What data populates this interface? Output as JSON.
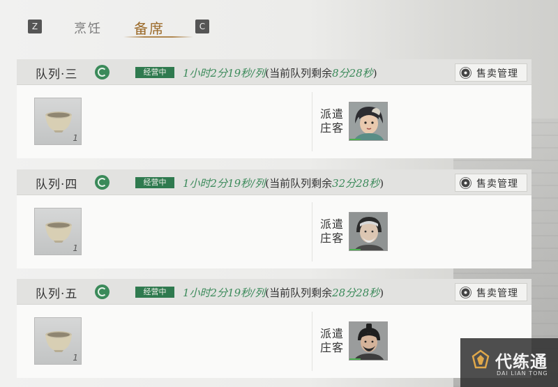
{
  "tabs": {
    "key_left": "Z",
    "key_right": "C",
    "cook": "烹饪",
    "prepare": "备席",
    "active": "prepare"
  },
  "queues": [
    {
      "name": "队列·三",
      "status": "经营中",
      "rate": "1小时2分19秒/列",
      "remain_prefix": "(当前队列剩余",
      "remain_time": "8分28秒",
      "remain_suffix": ")",
      "sell_label": "售卖管理",
      "item_count": "1",
      "item_icon": "ceramic-bowl",
      "dispatch_label": "派遣庄客",
      "portrait": "female-villager"
    },
    {
      "name": "队列·四",
      "status": "经营中",
      "rate": "1小时2分19秒/列",
      "remain_prefix": "(当前队列剩余",
      "remain_time": "32分28秒",
      "remain_suffix": ")",
      "sell_label": "售卖管理",
      "item_count": "1",
      "item_icon": "ceramic-bowl",
      "dispatch_label": "派遣庄客",
      "portrait": "old-man-villager"
    },
    {
      "name": "队列·五",
      "status": "经营中",
      "rate": "1小时2分19秒/列",
      "remain_prefix": "(当前队列剩余",
      "remain_time": "28分28秒",
      "remain_suffix": ")",
      "sell_label": "售卖管理",
      "item_count": "1",
      "item_icon": "ceramic-bowl",
      "dispatch_label": "派遣庄客",
      "portrait": "bearded-man-villager"
    }
  ],
  "watermark": {
    "title": "代练通",
    "subtitle": "DAI LIAN TONG"
  },
  "colors": {
    "status_green": "#2f7a4f",
    "time_green": "#3b8a5a",
    "active_tab": "#9b6a2a"
  }
}
